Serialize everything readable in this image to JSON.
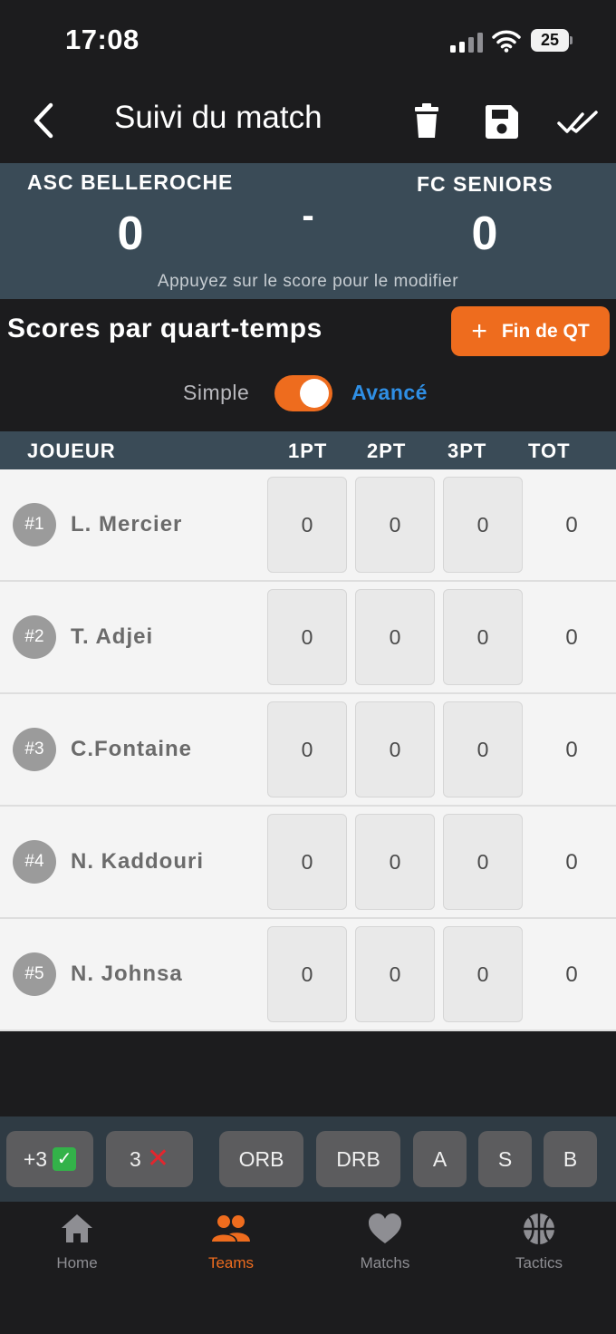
{
  "status_bar": {
    "time": "17:08",
    "battery": "25"
  },
  "nav": {
    "title": "Suivi du match"
  },
  "scoreboard": {
    "home_team": "ASC BELLEROCHE",
    "away_team": "FC SENIORS",
    "home_score": "0",
    "away_score": "0",
    "separator": "-",
    "hint": "Appuyez sur le score pour le modifier"
  },
  "section": {
    "title": "Scores par quart-temps",
    "fin_qt_label": "Fin de QT",
    "mode_simple": "Simple",
    "mode_advanced": "Avancé",
    "advanced_enabled": true
  },
  "table": {
    "headers": {
      "player": "JOUEUR",
      "pt1": "1PT",
      "pt2": "2PT",
      "pt3": "3PT",
      "total": "TOT"
    },
    "rows": [
      {
        "number": "#1",
        "name": "L. Mercier",
        "pt1": "0",
        "pt2": "0",
        "pt3": "0",
        "total": "0"
      },
      {
        "number": "#2",
        "name": "T. Adjei",
        "pt1": "0",
        "pt2": "0",
        "pt3": "0",
        "total": "0"
      },
      {
        "number": "#3",
        "name": "C.Fontaine",
        "pt1": "0",
        "pt2": "0",
        "pt3": "0",
        "total": "0"
      },
      {
        "number": "#4",
        "name": "N. Kaddouri",
        "pt1": "0",
        "pt2": "0",
        "pt3": "0",
        "total": "0"
      },
      {
        "number": "#5",
        "name": "N. Johnsa",
        "pt1": "0",
        "pt2": "0",
        "pt3": "0",
        "total": "0"
      }
    ]
  },
  "actions": {
    "three_made": "+3",
    "three_missed": "3",
    "orb": "ORB",
    "drb": "DRB",
    "assist": "A",
    "steal": "S",
    "block": "B"
  },
  "tabs": [
    {
      "label": "Home",
      "icon": "home-icon"
    },
    {
      "label": "Teams",
      "icon": "people-icon"
    },
    {
      "label": "Matchs",
      "icon": "heart-icon"
    },
    {
      "label": "Tactics",
      "icon": "basketball-icon"
    }
  ],
  "colors": {
    "accent": "#ee6c1e",
    "link": "#2f8fe5",
    "header_bg": "#3a4b57"
  }
}
